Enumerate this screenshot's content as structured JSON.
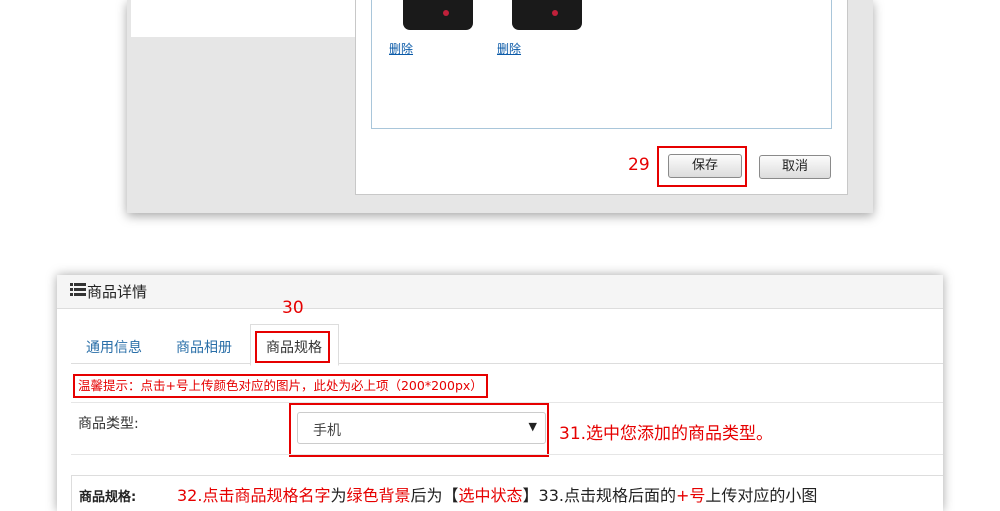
{
  "top": {
    "delete_links": [
      "删除",
      "删除"
    ],
    "save_button": "保存",
    "cancel_button": "取消",
    "annotation_29": "29"
  },
  "bottom": {
    "header_title": "商品详情",
    "tabs": [
      "通用信息",
      "商品相册",
      "商品规格"
    ],
    "annotation_30": "30",
    "notice": "温馨提示：点击+号上传颜色对应的图片，此处为必上项（200*200px）",
    "type_label": "商品类型:",
    "type_select_value": "手机",
    "annotation_31": "31.选中您添加的商品类型。",
    "spec_label": "商品规格:",
    "annotation_32_33": {
      "parts": [
        "32.点击",
        "商品规格名字",
        "为",
        "绿色背景",
        "后为【",
        "选中状态",
        "】33.点击规格后面的",
        "+号",
        "上传对应的小图"
      ]
    }
  },
  "colors": {
    "highlight": "#e60000",
    "tab_link": "#2a6fa8",
    "delete_link": "#0a5aa8"
  },
  "icons": [
    "list-icon",
    "caret-down-icon"
  ]
}
